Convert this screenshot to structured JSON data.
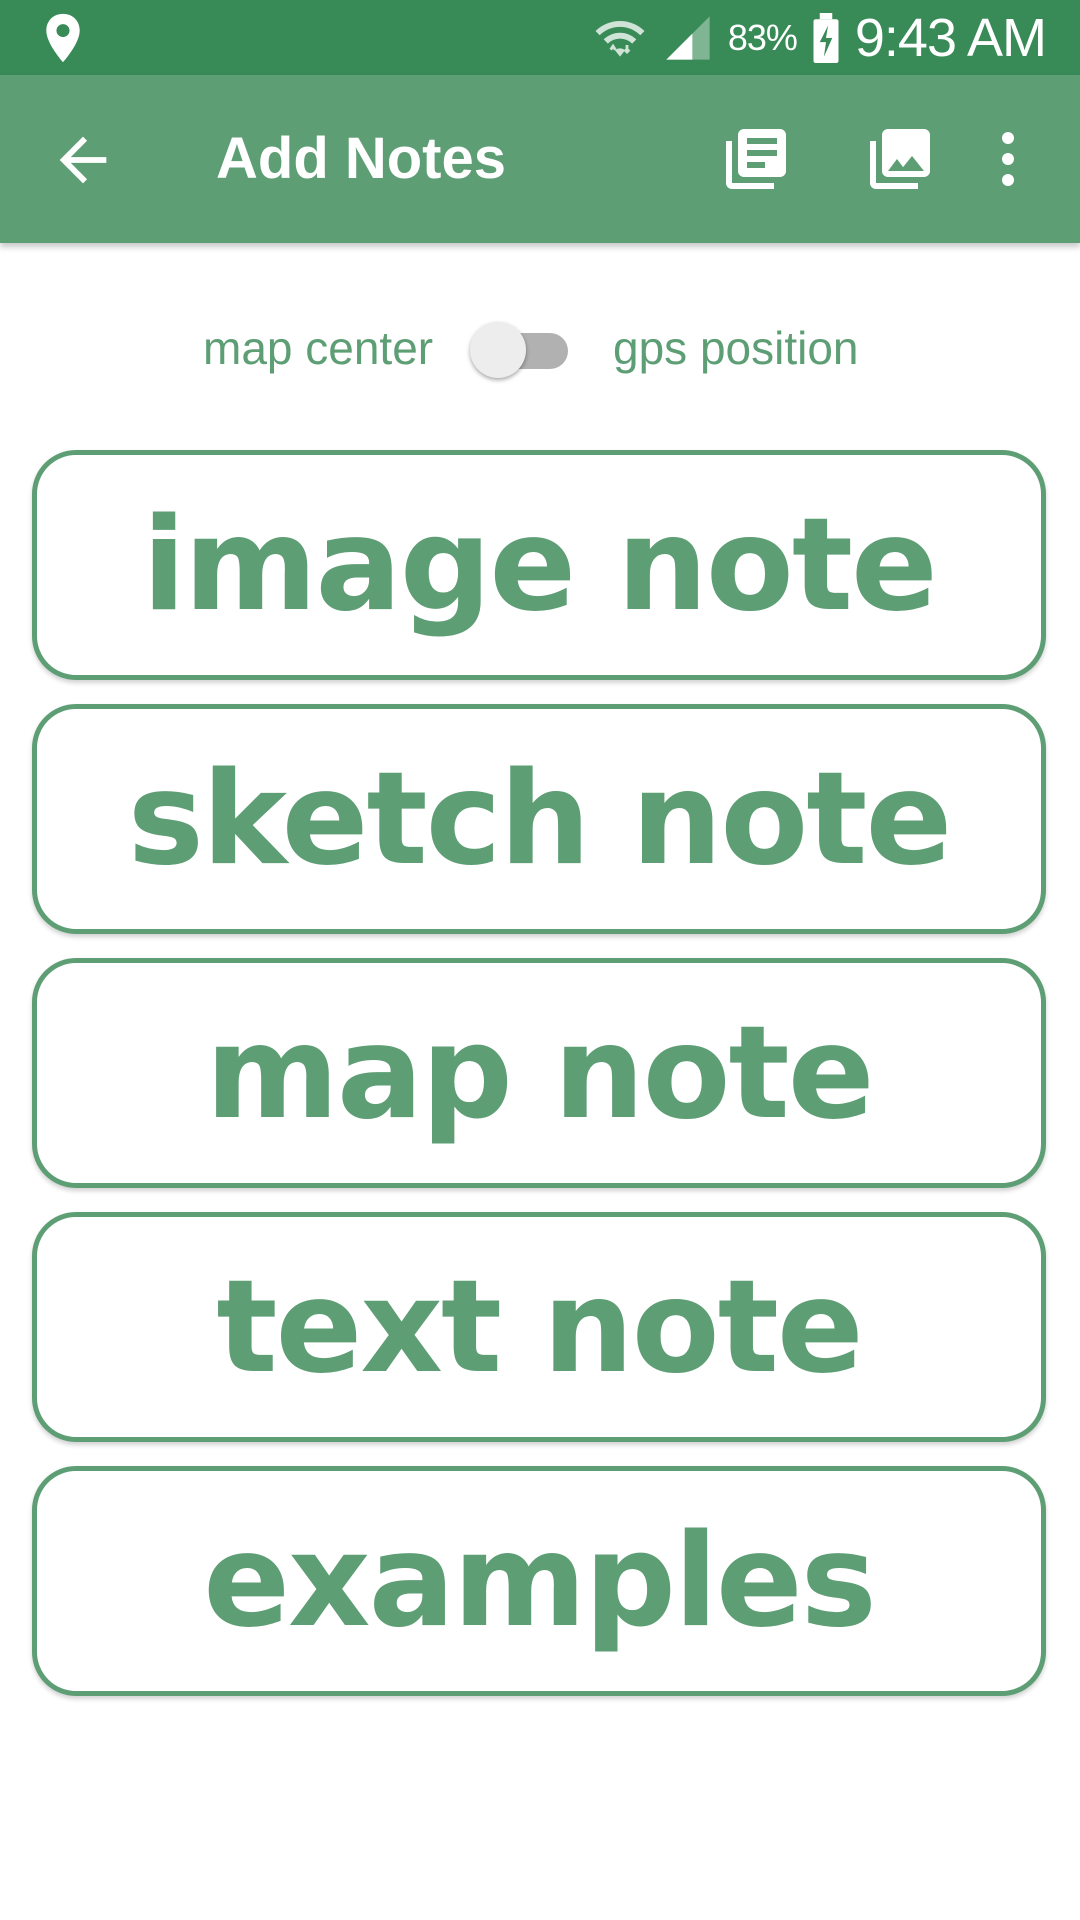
{
  "status_bar": {
    "icons": [
      "location-pin-icon",
      "wifi-icon",
      "cell-signal-icon",
      "battery-charging-icon"
    ],
    "battery": "83%",
    "time": "9:43 AM"
  },
  "app_bar": {
    "title": "Add Notes",
    "icons": [
      "back-arrow-icon",
      "notes-list-icon",
      "image-gallery-icon",
      "more-vert-icon"
    ]
  },
  "position_toggle": {
    "left_label": "map center",
    "right_label": "gps position",
    "state": "off"
  },
  "buttons": [
    {
      "label": "image note"
    },
    {
      "label": "sketch note"
    },
    {
      "label": "map note"
    },
    {
      "label": "text note"
    },
    {
      "label": "examples"
    }
  ],
  "colors": {
    "status_bar": "#388a57",
    "app_bar": "#5e9e75",
    "accent": "#5e9e75",
    "background": "#ffffff"
  }
}
